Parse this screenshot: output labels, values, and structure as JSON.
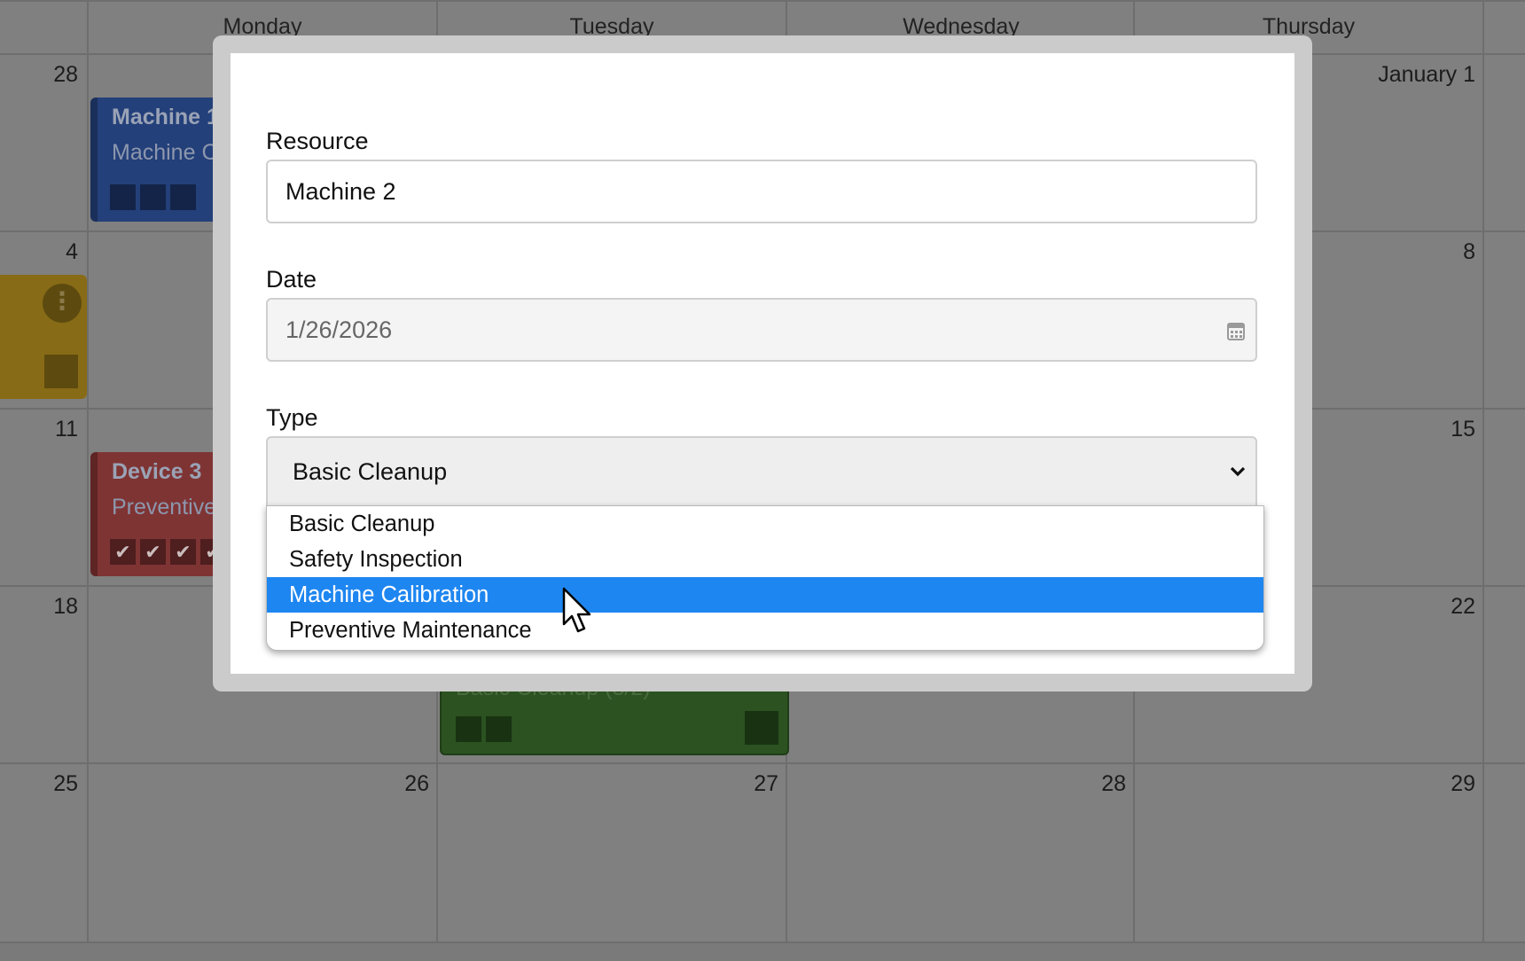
{
  "calendar": {
    "day_headers": [
      "Monday",
      "Tuesday",
      "Wednesday",
      "Thursday"
    ],
    "week_rows": [
      {
        "left_day": "28",
        "right_day": "January 1"
      },
      {
        "left_day": "4",
        "right_day": "8"
      },
      {
        "left_day": "11",
        "right_day": "15"
      },
      {
        "left_day": "18",
        "right_day": "22"
      },
      {
        "days": [
          "25",
          "26",
          "27",
          "28",
          "29"
        ]
      }
    ],
    "events": {
      "blue": {
        "title": "Machine 1",
        "subtitle": "Machine C"
      },
      "red": {
        "title": "Device 3",
        "subtitle": "Preventive"
      },
      "green": {
        "subtitle": "Basic Cleanup (3/2)"
      },
      "yellow": {
        "menu": "⋮"
      }
    }
  },
  "modal": {
    "resource": {
      "label": "Resource",
      "value": "Machine 2"
    },
    "date": {
      "label": "Date",
      "value": "1/26/2026"
    },
    "type": {
      "label": "Type",
      "selected": "Basic Cleanup",
      "options": [
        "Basic Cleanup",
        "Safety Inspection",
        "Machine Calibration",
        "Preventive Maintenance"
      ],
      "highlighted": "Machine Calibration"
    }
  },
  "colors": {
    "highlight": "#1e86f0",
    "overlay": "#808080"
  },
  "icons": {
    "date": "calendar-icon",
    "select": "chevron-down-icon",
    "pointer": "mouse-cursor-icon"
  }
}
